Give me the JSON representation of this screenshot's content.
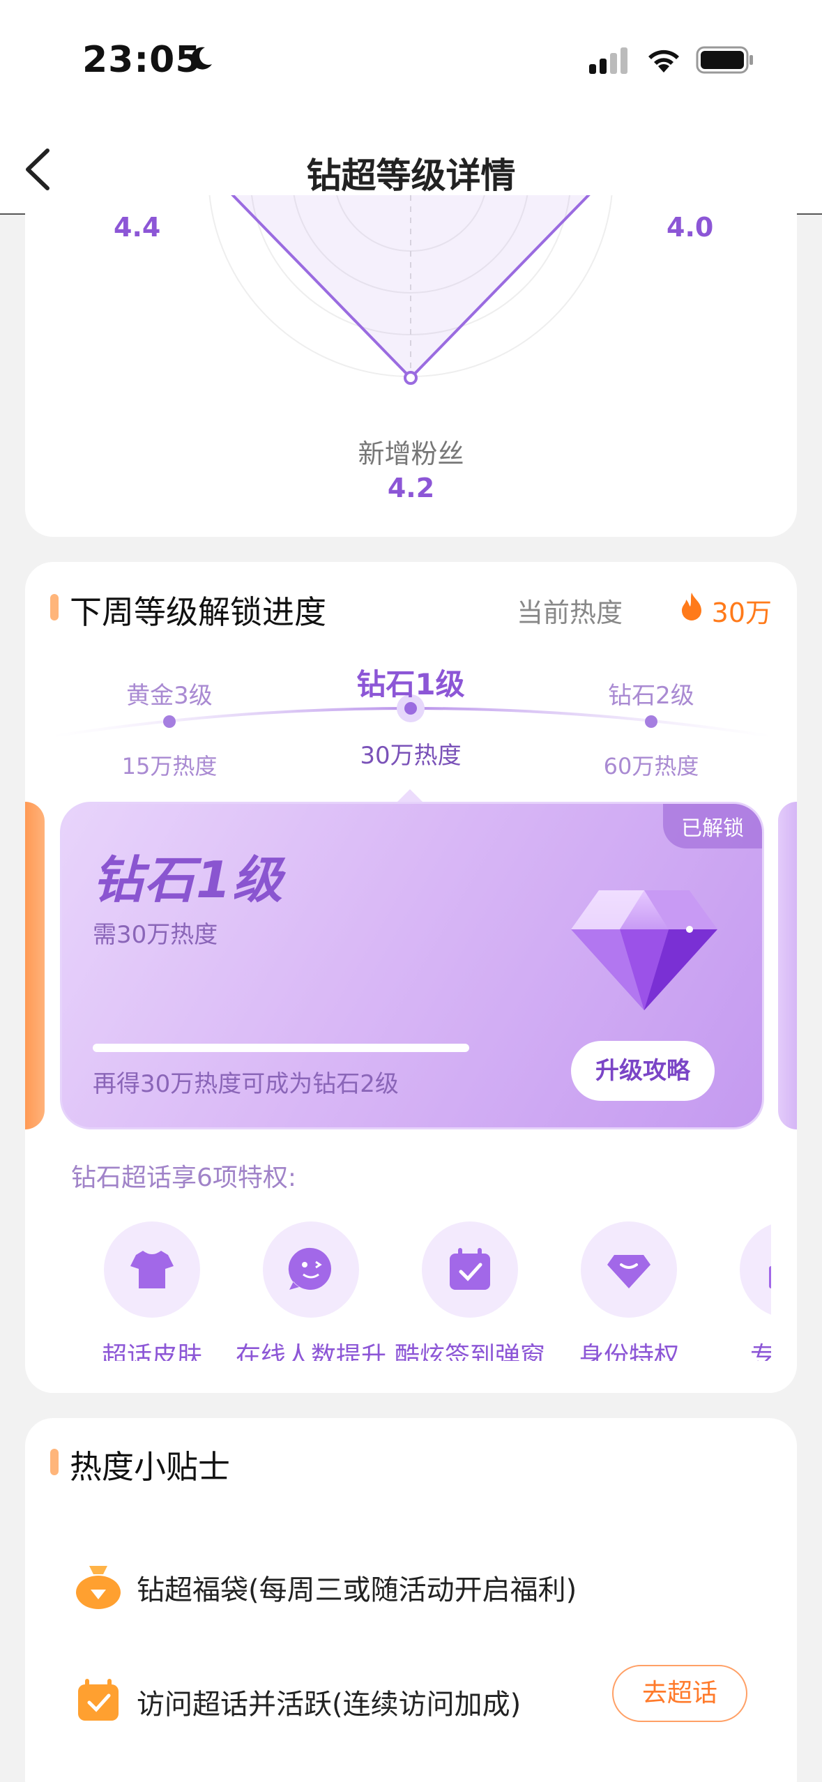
{
  "status": {
    "time": "23:05"
  },
  "nav": {
    "title": "钻超等级详情"
  },
  "radar": {
    "left_value": "4.4",
    "right_value": "4.0",
    "bottom_label": "新增粉丝",
    "bottom_value": "4.2"
  },
  "unlock": {
    "title": "下周等级解锁进度",
    "heat_label": "当前热度",
    "heat_value": "30万",
    "levels": [
      {
        "name": "黄金3级",
        "heat": "15万热度"
      },
      {
        "name": "钻石1级",
        "heat": "30万热度"
      },
      {
        "name": "钻石2级",
        "heat": "60万热度"
      }
    ],
    "card": {
      "badge": "已解锁",
      "name": "钻石1级",
      "requirement": "需30万热度",
      "progress": 1.0,
      "tip": "再得30万热度可成为钻石2级",
      "button": "升级攻略"
    },
    "privileges_title": "钻石超话享6项特权:",
    "privileges": [
      {
        "label": "超话皮肤",
        "icon": "shirt-icon"
      },
      {
        "label": "在线人数提升",
        "icon": "wink-face-icon"
      },
      {
        "label": "酷炫签到弹窗",
        "icon": "calendar-check-icon"
      },
      {
        "label": "身份特权",
        "icon": "gem-badge-icon"
      },
      {
        "label": "专属扌",
        "icon": "thumb-icon"
      }
    ]
  },
  "tips": {
    "title": "热度小贴士",
    "items": [
      {
        "text": "钻超福袋(每周三或随活动开启福利)",
        "icon": "lucky-bag-icon"
      },
      {
        "text": "访问超话并活跃(连续访问加成)",
        "icon": "calendar-check-icon",
        "button": "去超话"
      }
    ]
  },
  "colors": {
    "accent": "#8c56d6",
    "orange": "#ff7a1a"
  }
}
